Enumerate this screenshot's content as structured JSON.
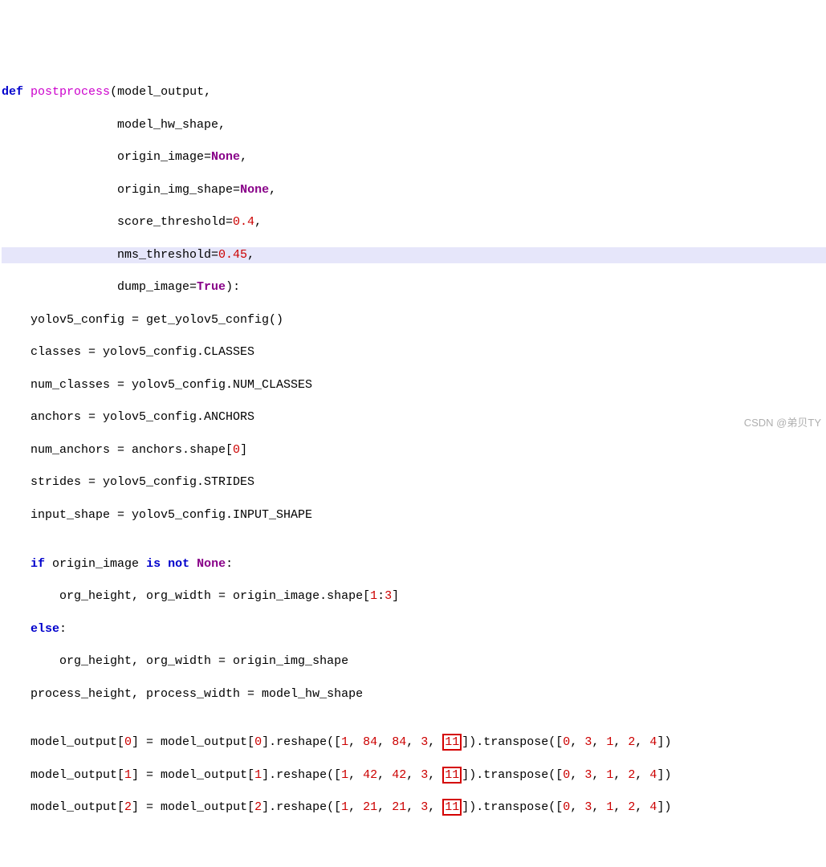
{
  "lines": {
    "l1_def": "def",
    "l1_fn": "postprocess",
    "l1_open": "(model_output,",
    "l2": "                model_hw_shape,",
    "l3a": "                origin_image=",
    "l3_none": "None",
    "l3b": ",",
    "l4a": "                origin_img_shape=",
    "l4_none": "None",
    "l4b": ",",
    "l5a": "                score_threshold=",
    "l5_num": "0.4",
    "l5b": ",",
    "l6a": "                nms_threshold=",
    "l6_num": "0.45",
    "l6b": ",",
    "l7a": "                dump_image=",
    "l7_bool": "True",
    "l7b": "):",
    "l8": "    yolov5_config = get_yolov5_config()",
    "l9": "    classes = yolov5_config.CLASSES",
    "l10": "    num_classes = yolov5_config.NUM_CLASSES",
    "l11": "    anchors = yolov5_config.ANCHORS",
    "l12a": "    num_anchors = anchors.shape[",
    "l12_num": "0",
    "l12b": "]",
    "l13": "    strides = yolov5_config.STRIDES",
    "l14": "    input_shape = yolov5_config.INPUT_SHAPE",
    "l15": "",
    "l16_if": "if",
    "l16a": " origin_image ",
    "l16_is": "is",
    "l16b": " ",
    "l16_not": "not",
    "l16c": " ",
    "l16_none": "None",
    "l16d": ":",
    "l17a": "        org_height, org_width = origin_image.shape[",
    "l17_n1": "1",
    "l17_colon": ":",
    "l17_n2": "3",
    "l17b": "]",
    "l18_else": "else",
    "l18b": ":",
    "l19": "        org_height, org_width = origin_img_shape",
    "l20": "    process_height, process_width = model_hw_shape",
    "l21": "",
    "mo0a": "    model_output[",
    "mo0_idx": "0",
    "mo0b": "] = model_output[",
    "mo0_idx2": "0",
    "mo0c": "].reshape([",
    "mo0_r1": "1",
    "mo0_r2": "84",
    "mo0_r3": "84",
    "mo0_r4": "3",
    "mo0_r5": "11",
    "mo0d": "]).transpose([",
    "mo0_t0": "0",
    "mo0_t1": "3",
    "mo0_t2": "1",
    "mo0_t3": "2",
    "mo0_t4": "4",
    "mo0e": "])",
    "mo1a": "    model_output[",
    "mo1_idx": "1",
    "mo1b": "] = model_output[",
    "mo1_idx2": "1",
    "mo1c": "].reshape([",
    "mo1_r1": "1",
    "mo1_r2": "42",
    "mo1_r3": "42",
    "mo1_r4": "3",
    "mo1_r5": "11",
    "mo1d": "]).transpose([",
    "mo1_t0": "0",
    "mo1_t1": "3",
    "mo1_t2": "1",
    "mo1_t3": "2",
    "mo1_t4": "4",
    "mo1e": "])",
    "mo2a": "    model_output[",
    "mo2_idx": "2",
    "mo2b": "] = model_output[",
    "mo2_idx2": "2",
    "mo2c": "].reshape([",
    "mo2_r1": "1",
    "mo2_r2": "21",
    "mo2_r3": "21",
    "mo2_r4": "3",
    "mo2_r5": "11",
    "mo2d": "]).transpose([",
    "mo2_t0": "0",
    "mo2_t1": "3",
    "mo2_t2": "1",
    "mo2_t3": "2",
    "mo2_t4": "4",
    "mo2e": "])",
    "comma": ", "
  },
  "watermark": "CSDN @弟贝TY"
}
